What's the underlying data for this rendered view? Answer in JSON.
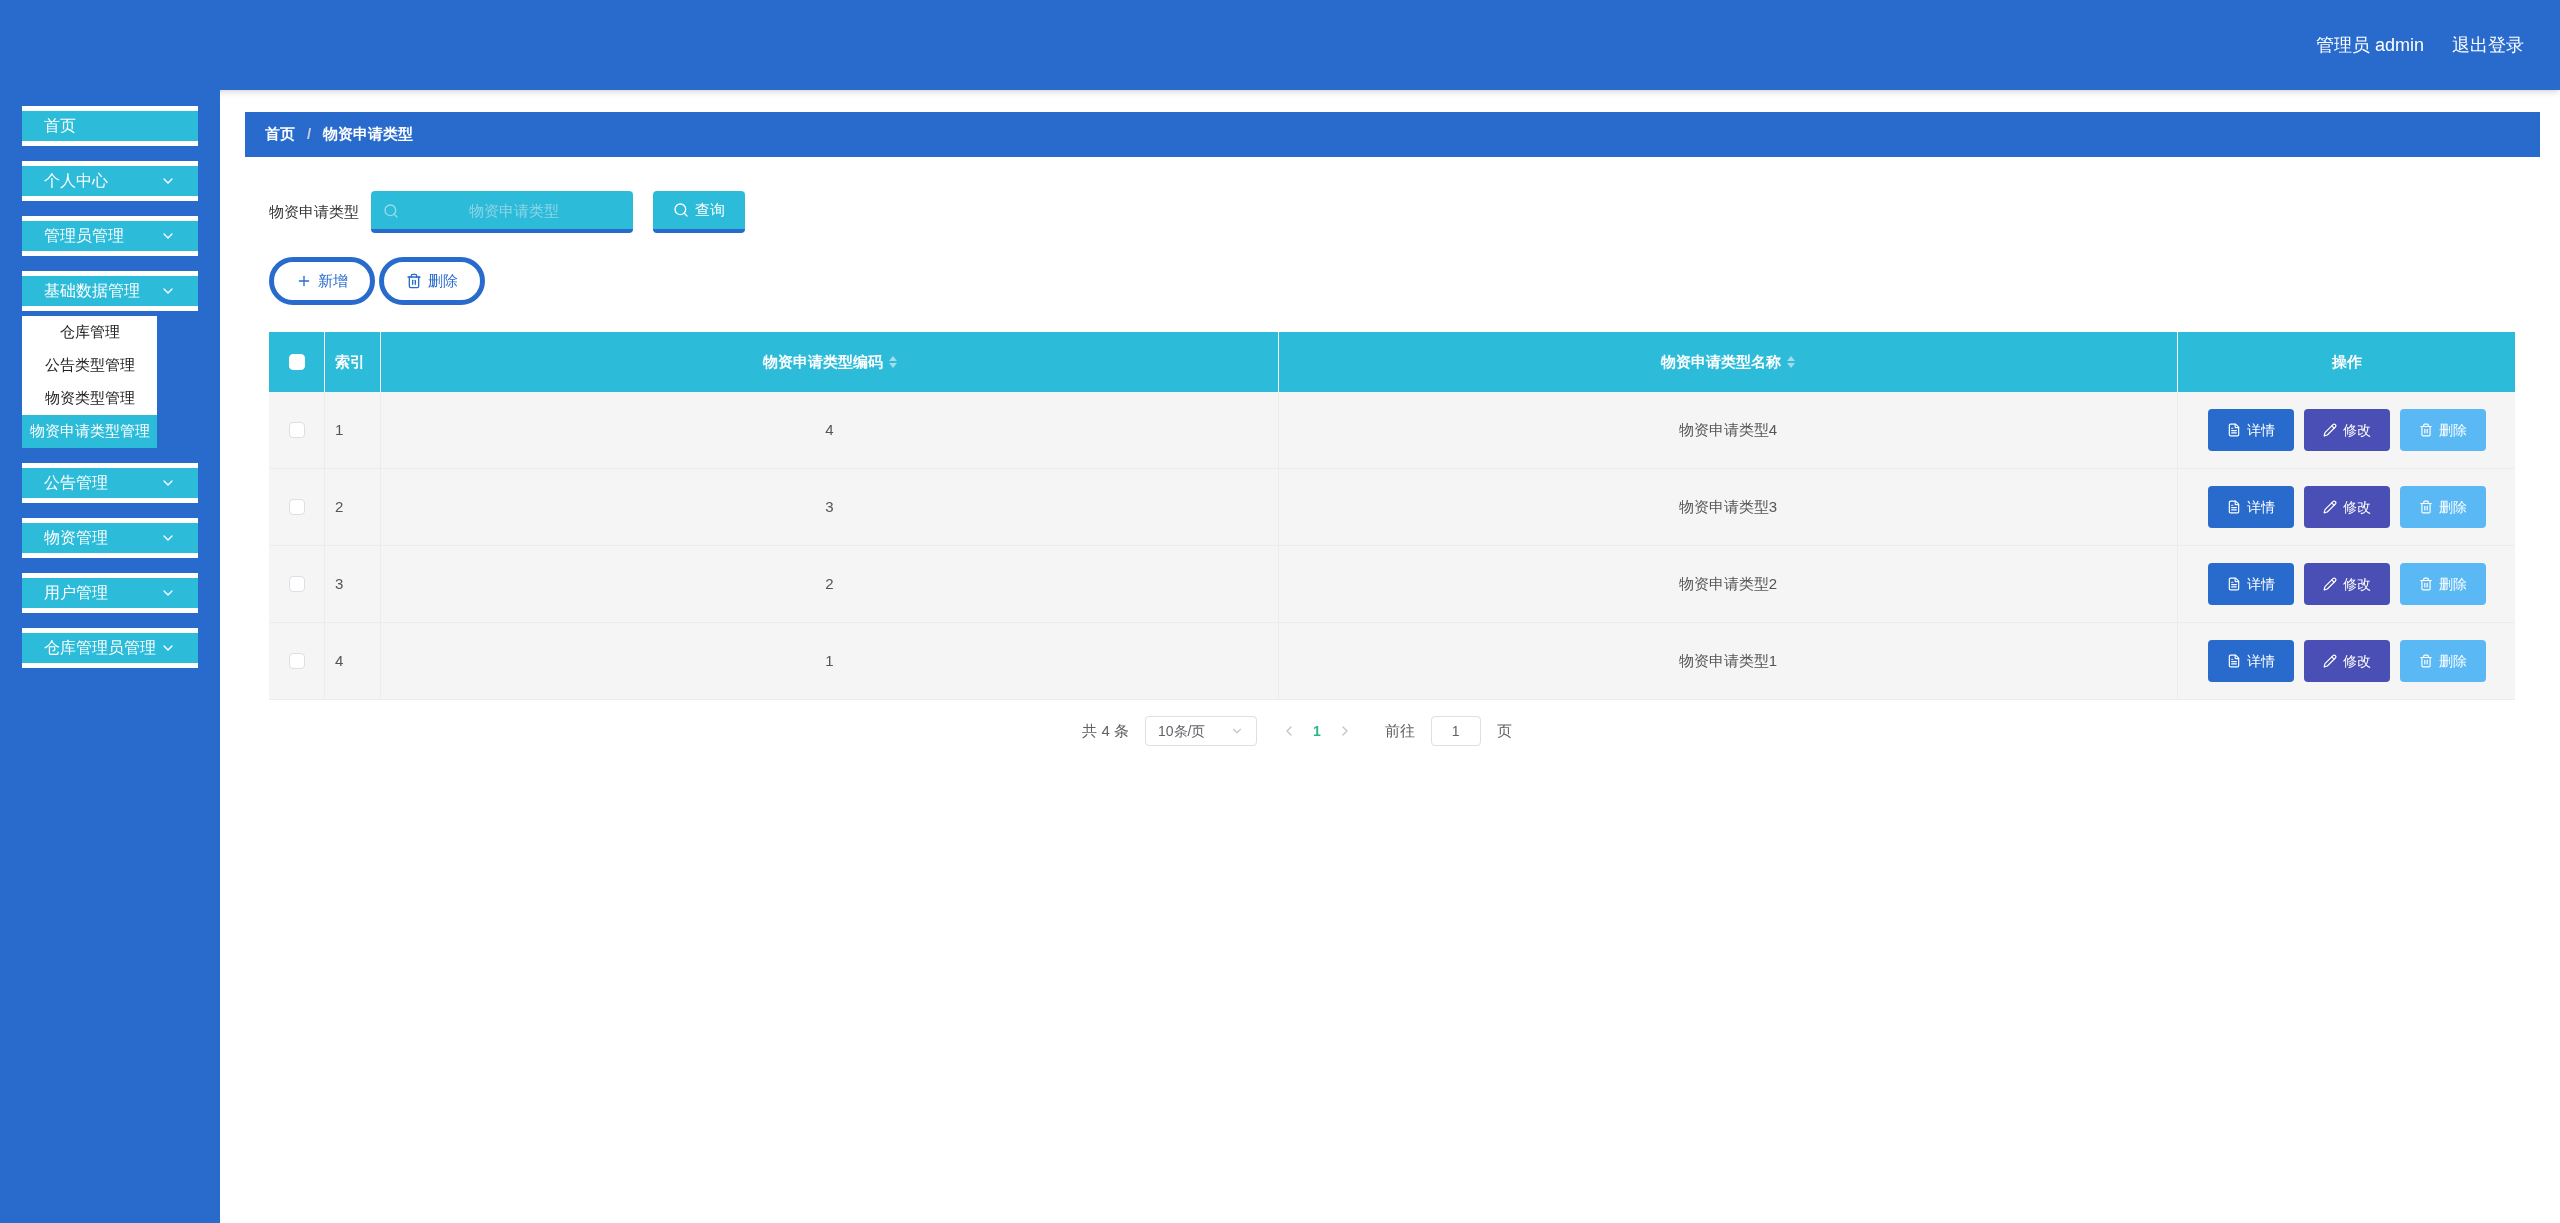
{
  "header": {
    "user": "管理员 admin",
    "logout": "退出登录"
  },
  "sidebar": {
    "items": [
      {
        "label": "首页",
        "kind": "link"
      },
      {
        "label": "个人中心",
        "kind": "group"
      },
      {
        "label": "管理员管理",
        "kind": "group"
      },
      {
        "label": "基础数据管理",
        "kind": "group",
        "children": [
          {
            "label": "仓库管理",
            "selected": false
          },
          {
            "label": "公告类型管理",
            "selected": false
          },
          {
            "label": "物资类型管理",
            "selected": false
          },
          {
            "label": "物资申请类型管理",
            "selected": true
          }
        ]
      },
      {
        "label": "公告管理",
        "kind": "group"
      },
      {
        "label": "物资管理",
        "kind": "group"
      },
      {
        "label": "用户管理",
        "kind": "group"
      },
      {
        "label": "仓库管理员管理",
        "kind": "group"
      }
    ]
  },
  "breadcrumb": [
    "首页",
    "物资申请类型"
  ],
  "breadcrumb_separator": "/",
  "search": {
    "label": "物资申请类型",
    "placeholder": "物资申请类型",
    "button": "查询"
  },
  "actions": {
    "add": "新增",
    "delete": "删除"
  },
  "table": {
    "columns": [
      {
        "label": "索引",
        "sortable": false
      },
      {
        "label": "物资申请类型编码",
        "sortable": true
      },
      {
        "label": "物资申请类型名称",
        "sortable": true
      },
      {
        "label": "操作",
        "sortable": false
      }
    ],
    "header_checked": false,
    "rows": [
      {
        "checked": false,
        "index": "1",
        "code": "4",
        "name": "物资申请类型4",
        "buttons": [
          {
            "kind": "detail",
            "label": "详情"
          },
          {
            "kind": "edit",
            "label": "修改"
          },
          {
            "kind": "delete",
            "label": "删除"
          }
        ]
      },
      {
        "checked": false,
        "index": "2",
        "code": "3",
        "name": "物资申请类型3",
        "buttons": [
          {
            "kind": "detail",
            "label": "详情"
          },
          {
            "kind": "edit",
            "label": "修改"
          },
          {
            "kind": "delete",
            "label": "删除"
          }
        ]
      },
      {
        "checked": false,
        "index": "3",
        "code": "2",
        "name": "物资申请类型2",
        "buttons": [
          {
            "kind": "detail",
            "label": "详情"
          },
          {
            "kind": "edit",
            "label": "修改"
          },
          {
            "kind": "delete",
            "label": "删除"
          }
        ]
      },
      {
        "checked": false,
        "index": "4",
        "code": "1",
        "name": "物资申请类型1",
        "buttons": [
          {
            "kind": "detail",
            "label": "详情"
          },
          {
            "kind": "edit",
            "label": "修改"
          },
          {
            "kind": "delete",
            "label": "删除"
          }
        ]
      }
    ]
  },
  "pagination": {
    "total": "共 4 条",
    "page_size": "10条/页",
    "pages": [
      {
        "label": "1",
        "selected": true
      }
    ],
    "goto_label": "前往",
    "goto_value": "1",
    "goto_suffix": "页"
  }
}
